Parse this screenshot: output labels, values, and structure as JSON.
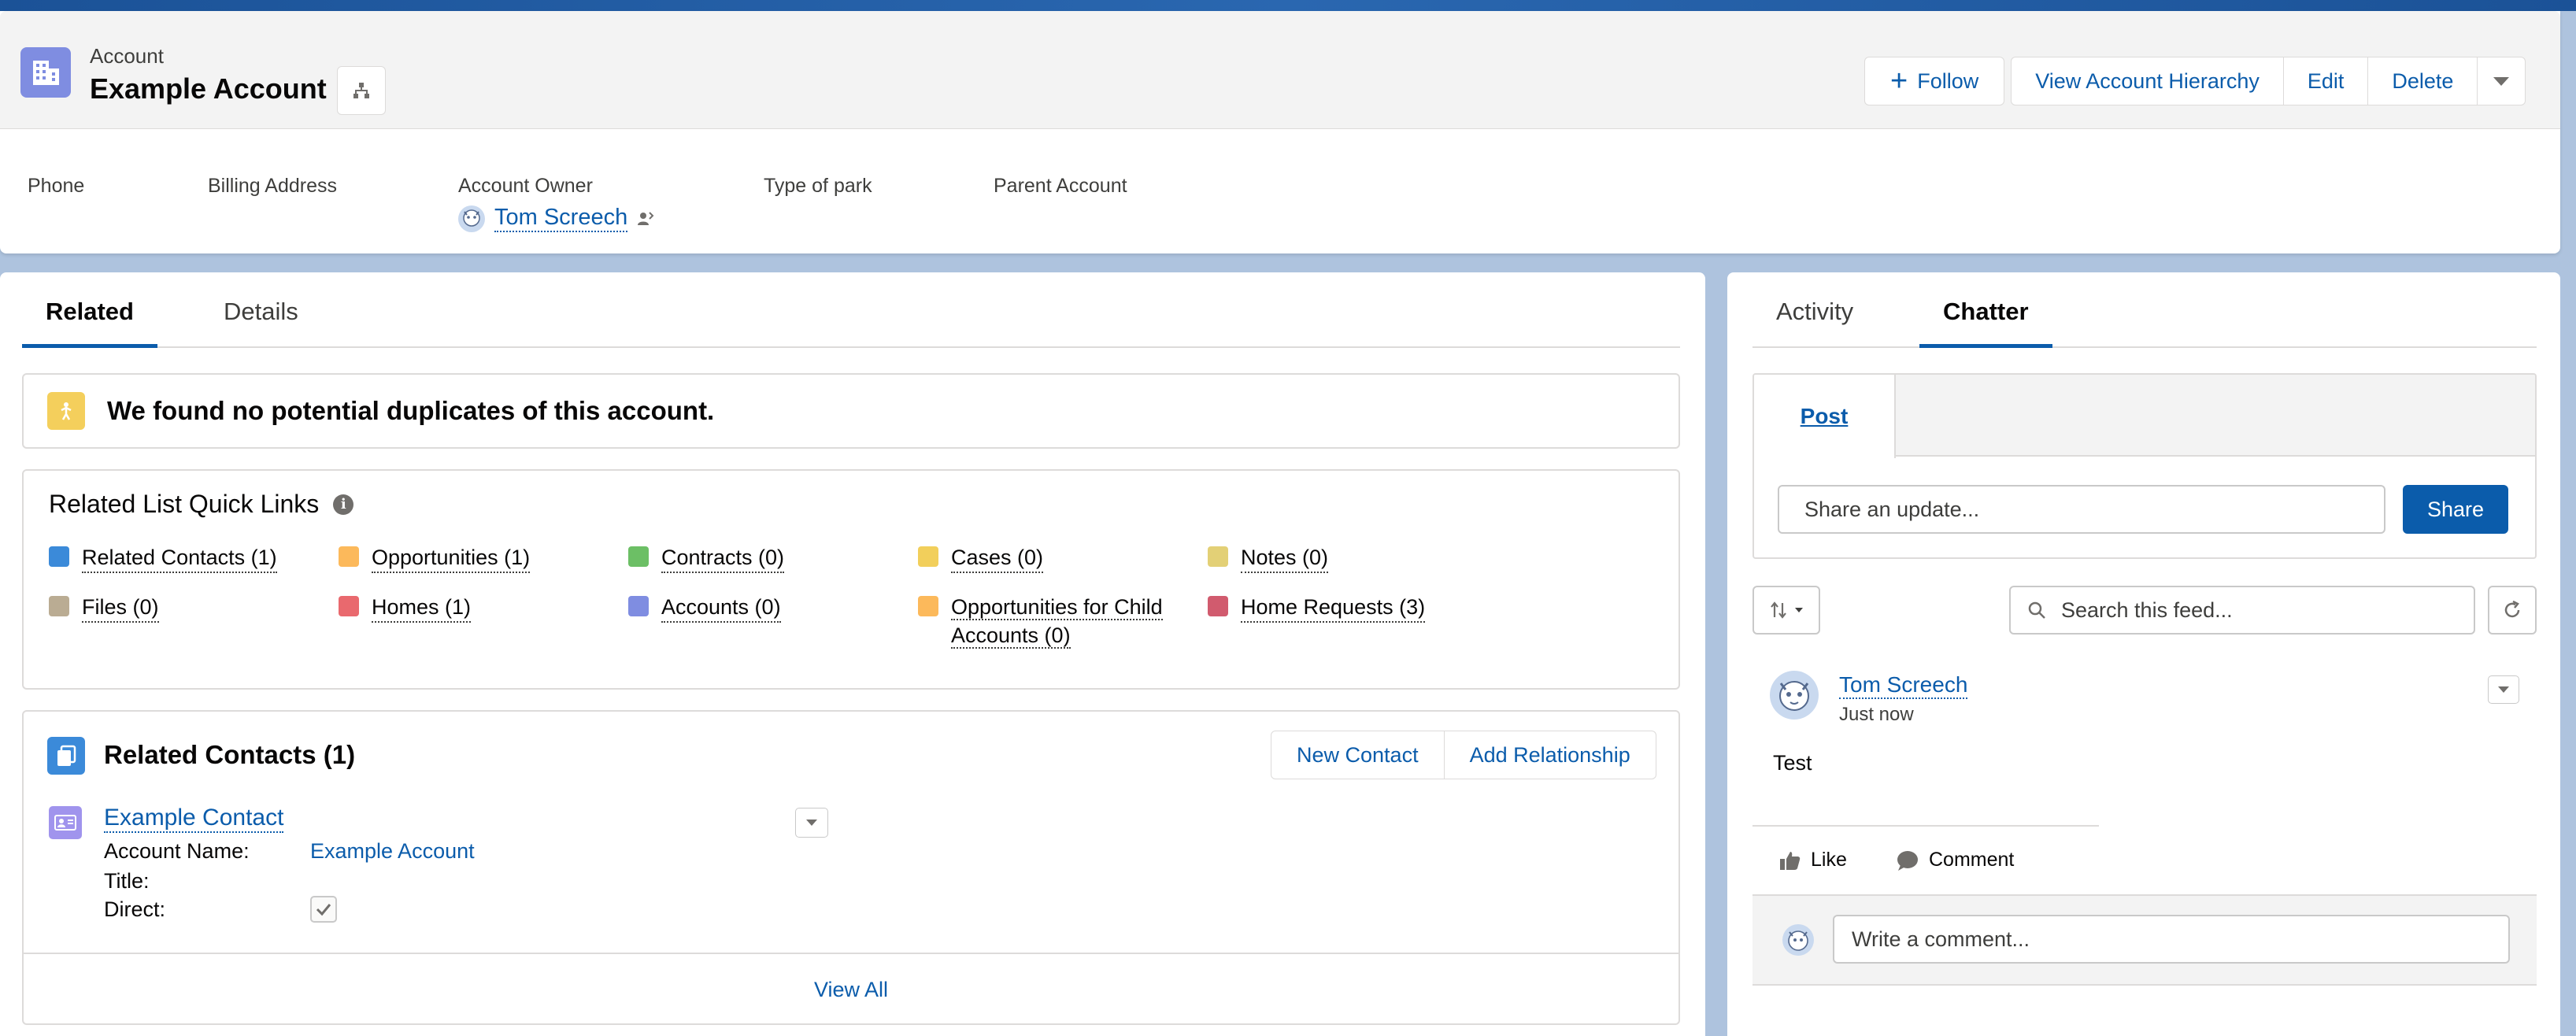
{
  "header": {
    "object_label": "Account",
    "record_name": "Example Account",
    "actions": {
      "follow": "Follow",
      "view_hierarchy": "View Account Hierarchy",
      "edit": "Edit",
      "delete": "Delete"
    },
    "fields": {
      "phone_label": "Phone",
      "billing_label": "Billing Address",
      "owner_label": "Account Owner",
      "owner_name": "Tom Screech",
      "park_label": "Type of park",
      "parent_label": "Parent Account"
    }
  },
  "main": {
    "tabs": [
      {
        "label": "Related",
        "active": true
      },
      {
        "label": "Details",
        "active": false
      }
    ],
    "duplicates_message": "We found no potential duplicates of this account.",
    "quick_links": {
      "title": "Related List Quick Links",
      "items": [
        {
          "label": "Related Contacts (1)",
          "color": "#3b8ad9"
        },
        {
          "label": "Opportunities (1)",
          "color": "#fcb95b"
        },
        {
          "label": "Contracts (0)",
          "color": "#6cbf65"
        },
        {
          "label": "Cases (0)",
          "color": "#f2cf5b"
        },
        {
          "label": "Notes (0)",
          "color": "#e3d076"
        },
        {
          "label": "Files (0)",
          "color": "#baac93"
        },
        {
          "label": "Homes (1)",
          "color": "#e9696e"
        },
        {
          "label": "Accounts (0)",
          "color": "#7f8de1"
        },
        {
          "label": "Opportunities for Child Accounts (0)",
          "color": "#fcb95b"
        },
        {
          "label": "Home Requests (3)",
          "color": "#d15b6e"
        }
      ]
    },
    "related_contacts": {
      "title": "Related Contacts (1)",
      "new_contact": "New Contact",
      "add_relationship": "Add Relationship",
      "contact": {
        "name": "Example Contact",
        "account_name_label": "Account Name:",
        "account_name_value": "Example Account",
        "title_label": "Title:",
        "direct_label": "Direct:",
        "direct_checked": true
      },
      "view_all": "View All"
    }
  },
  "side": {
    "tabs": [
      {
        "label": "Activity",
        "active": false
      },
      {
        "label": "Chatter",
        "active": true
      }
    ],
    "publisher": {
      "tab_label": "Post",
      "placeholder": "Share an update...",
      "share": "Share"
    },
    "feed_search_placeholder": "Search this feed...",
    "post": {
      "author": "Tom Screech",
      "time": "Just now",
      "body": "Test",
      "like": "Like",
      "comment": "Comment",
      "comment_placeholder": "Write a comment..."
    }
  },
  "colors": {
    "brand": "#0b5cab",
    "account_icon": "#7f8de1",
    "warning_icon": "#f4cf5c"
  }
}
